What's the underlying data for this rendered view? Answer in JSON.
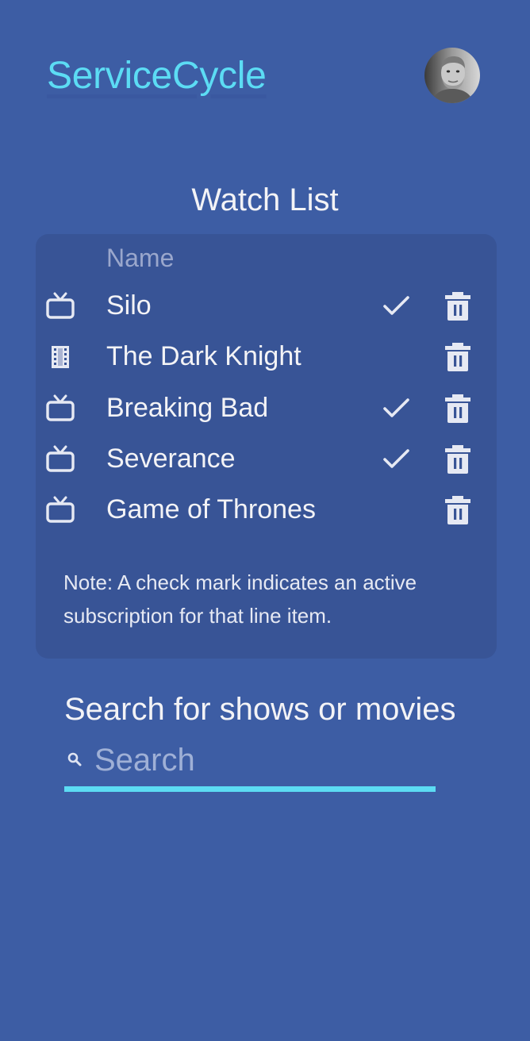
{
  "header": {
    "app_title": "ServiceCycle",
    "avatar_icon": "user-avatar"
  },
  "watchlist": {
    "title": "Watch List",
    "column_name": "Name",
    "items": [
      {
        "type": "tv",
        "icon": "tv-icon",
        "name": "Silo",
        "active_subscription": true
      },
      {
        "type": "movie",
        "icon": "film-icon",
        "name": "The Dark Knight",
        "active_subscription": false
      },
      {
        "type": "tv",
        "icon": "tv-icon",
        "name": "Breaking Bad",
        "active_subscription": true
      },
      {
        "type": "tv",
        "icon": "tv-icon",
        "name": "Severance",
        "active_subscription": true
      },
      {
        "type": "tv",
        "icon": "tv-icon",
        "name": "Game of Thrones",
        "active_subscription": false
      }
    ],
    "note": "Note: A check mark indicates an active subscription for that line item."
  },
  "search": {
    "heading": "Search for shows or movies",
    "placeholder": "Search",
    "value": ""
  },
  "colors": {
    "background": "#3d5da4",
    "card": "#385496",
    "accent": "#5cdcf4",
    "text": "#f3f3f6",
    "muted": "#9aa7cc"
  }
}
